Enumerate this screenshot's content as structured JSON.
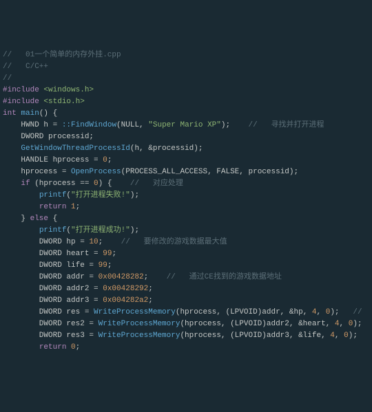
{
  "lines": [
    [
      [
        "c-comment",
        "//   01一个简单的内存外挂.cpp"
      ]
    ],
    [
      [
        "c-comment",
        "//   C/C++"
      ]
    ],
    [
      [
        "c-comment",
        "//"
      ]
    ],
    [
      [
        "c-pre",
        "#include "
      ],
      [
        "c-inc",
        "<windows.h>"
      ]
    ],
    [
      [
        "c-pre",
        "#include "
      ],
      [
        "c-inc",
        "<stdio.h>"
      ]
    ],
    [
      [
        "",
        ""
      ]
    ],
    [
      [
        "c-kw",
        "int"
      ],
      [
        "",
        " "
      ],
      [
        "c-fn",
        "main"
      ],
      [
        "c-op",
        "() {"
      ]
    ],
    [
      [
        "",
        "    HWND h = "
      ],
      [
        "c-fn",
        "::FindWindow"
      ],
      [
        "c-op",
        "(NULL, "
      ],
      [
        "c-str",
        "\"Super Mario XP\""
      ],
      [
        "c-op",
        ");    "
      ],
      [
        "c-comment",
        "//   寻找并打开进程"
      ]
    ],
    [
      [
        "",
        "    DWORD processid;"
      ]
    ],
    [
      [
        "",
        "    "
      ],
      [
        "c-fn",
        "GetWindowThreadProcessId"
      ],
      [
        "c-op",
        "(h, &processid);"
      ]
    ],
    [
      [
        "",
        "    HANDLE hprocess = "
      ],
      [
        "c-num",
        "0"
      ],
      [
        "c-op",
        ";"
      ]
    ],
    [
      [
        "",
        "    hprocess = "
      ],
      [
        "c-fn",
        "OpenProcess"
      ],
      [
        "c-op",
        "(PROCESS_ALL_ACCESS, FALSE, processid);"
      ]
    ],
    [
      [
        "",
        ""
      ]
    ],
    [
      [
        "",
        "    "
      ],
      [
        "c-kw",
        "if"
      ],
      [
        "",
        " (hprocess == "
      ],
      [
        "c-num",
        "0"
      ],
      [
        "c-op",
        ") {    "
      ],
      [
        "c-comment",
        "//   对应处理"
      ]
    ],
    [
      [
        "",
        "        "
      ],
      [
        "c-fn",
        "printf"
      ],
      [
        "c-op",
        "("
      ],
      [
        "c-str",
        "\"打开进程失败!\""
      ],
      [
        "c-op",
        ");"
      ]
    ],
    [
      [
        "",
        "        "
      ],
      [
        "c-kw",
        "return"
      ],
      [
        "",
        " "
      ],
      [
        "c-num",
        "1"
      ],
      [
        "c-op",
        ";"
      ]
    ],
    [
      [
        "",
        "    } "
      ],
      [
        "c-kw",
        "else"
      ],
      [
        "",
        " {"
      ]
    ],
    [
      [
        "",
        "        "
      ],
      [
        "c-fn",
        "printf"
      ],
      [
        "c-op",
        "("
      ],
      [
        "c-str",
        "\"打开进程成功!\""
      ],
      [
        "c-op",
        ");"
      ]
    ],
    [
      [
        "",
        ""
      ]
    ],
    [
      [
        "",
        "        DWORD hp = "
      ],
      [
        "c-num",
        "10"
      ],
      [
        "c-op",
        ";    "
      ],
      [
        "c-comment",
        "//   要修改的游戏数据最大值"
      ]
    ],
    [
      [
        "",
        "        DWORD heart = "
      ],
      [
        "c-num",
        "99"
      ],
      [
        "c-op",
        ";"
      ]
    ],
    [
      [
        "",
        "        DWORD life = "
      ],
      [
        "c-num",
        "99"
      ],
      [
        "c-op",
        ";"
      ]
    ],
    [
      [
        "",
        ""
      ]
    ],
    [
      [
        "",
        "        DWORD addr = "
      ],
      [
        "c-num",
        "0x00428282"
      ],
      [
        "c-op",
        ";    "
      ],
      [
        "c-comment",
        "//   通过CE找到的游戏数据地址"
      ]
    ],
    [
      [
        "",
        "        DWORD addr2 = "
      ],
      [
        "c-num",
        "0x00428292"
      ],
      [
        "c-op",
        ";"
      ]
    ],
    [
      [
        "",
        "        DWORD addr3 = "
      ],
      [
        "c-num",
        "0x004282a2"
      ],
      [
        "c-op",
        ";"
      ]
    ],
    [
      [
        "",
        ""
      ]
    ],
    [
      [
        "",
        "        DWORD res = "
      ],
      [
        "c-fn",
        "WriteProcessMemory"
      ],
      [
        "c-op",
        "(hprocess, (LPVOID)addr, &hp, "
      ],
      [
        "c-num",
        "4"
      ],
      [
        "c-op",
        ", "
      ],
      [
        "c-num",
        "0"
      ],
      [
        "c-op",
        ");   "
      ],
      [
        "c-comment",
        "//   写入"
      ]
    ],
    [
      [
        "",
        "        DWORD res2 = "
      ],
      [
        "c-fn",
        "WriteProcessMemory"
      ],
      [
        "c-op",
        "(hprocess, (LPVOID)addr2, &heart, "
      ],
      [
        "c-num",
        "4"
      ],
      [
        "c-op",
        ", "
      ],
      [
        "c-num",
        "0"
      ],
      [
        "c-op",
        ");"
      ]
    ],
    [
      [
        "",
        "        DWORD res3 = "
      ],
      [
        "c-fn",
        "WriteProcessMemory"
      ],
      [
        "c-op",
        "(hprocess, (LPVOID)addr3, &life, "
      ],
      [
        "c-num",
        "4"
      ],
      [
        "c-op",
        ", "
      ],
      [
        "c-num",
        "0"
      ],
      [
        "c-op",
        ");"
      ]
    ],
    [
      [
        "",
        ""
      ]
    ],
    [
      [
        "",
        "        "
      ],
      [
        "c-kw",
        "return"
      ],
      [
        "",
        " "
      ],
      [
        "c-num",
        "0"
      ],
      [
        "c-op",
        ";"
      ]
    ]
  ]
}
